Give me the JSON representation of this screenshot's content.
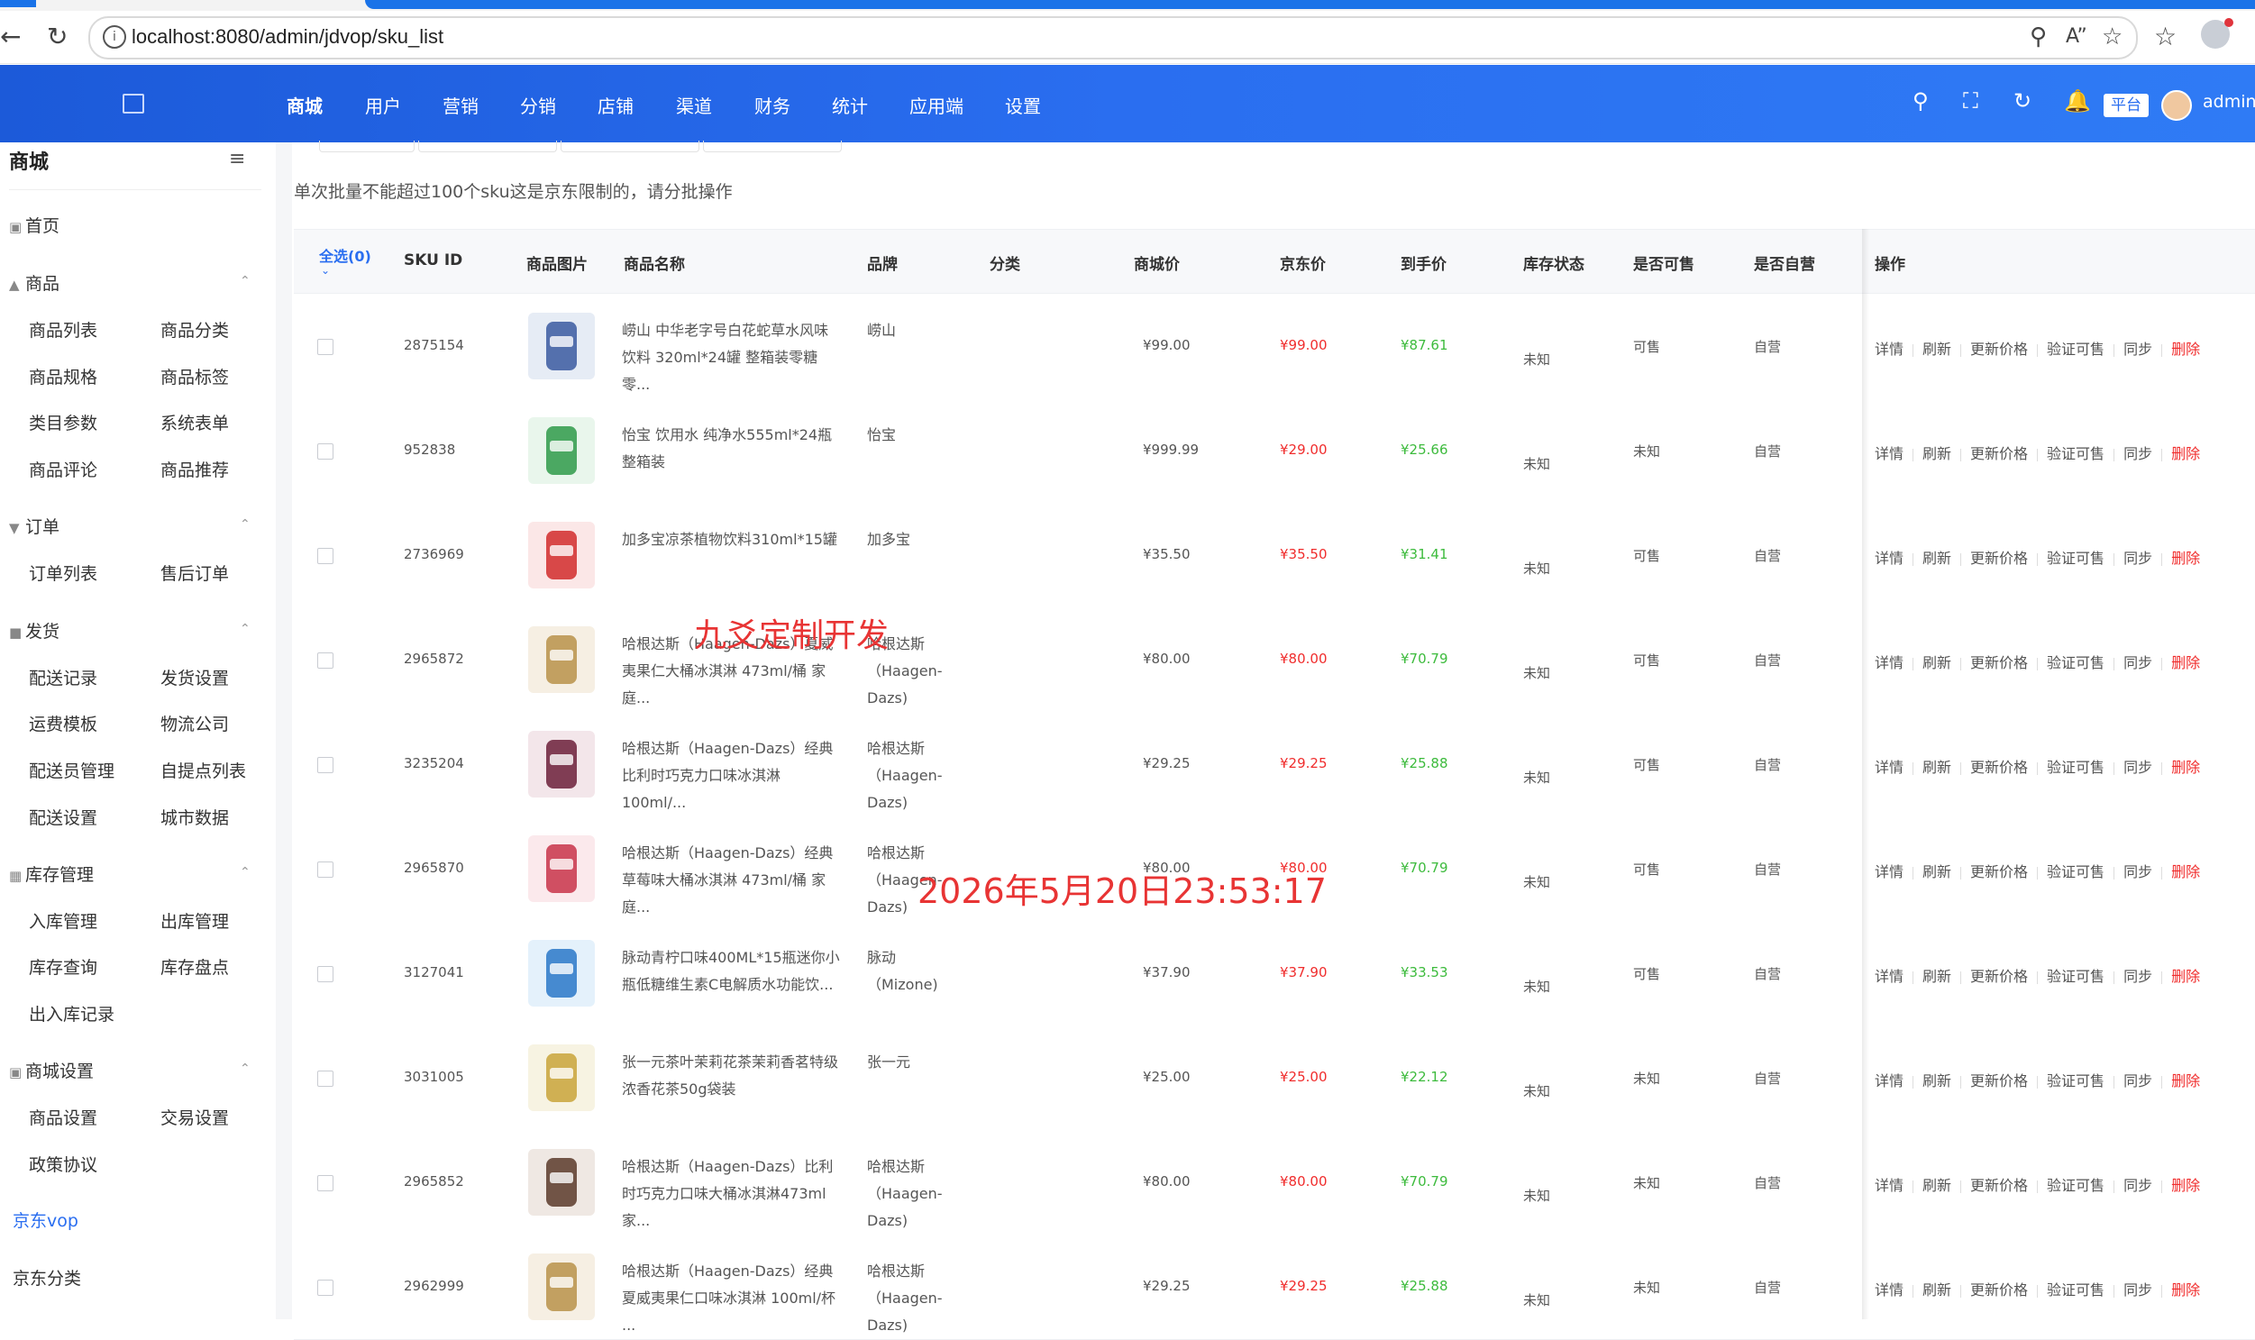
{
  "browser": {
    "url": "localhost:8080/admin/jdvop/sku_list"
  },
  "topnav": {
    "items": [
      "商城",
      "用户",
      "营销",
      "分销",
      "店铺",
      "渠道",
      "财务",
      "统计",
      "应用端",
      "设置"
    ],
    "platform_badge": "平台",
    "user": "admin"
  },
  "sidebar": {
    "title": "商城",
    "home": "首页",
    "sections": [
      {
        "title": "商品",
        "items": [
          "商品列表",
          "商品分类",
          "商品规格",
          "商品标签",
          "类目参数",
          "系统表单",
          "商品评论",
          "商品推荐"
        ]
      },
      {
        "title": "订单",
        "items": [
          "订单列表",
          "售后订单"
        ]
      },
      {
        "title": "发货",
        "items": [
          "配送记录",
          "发货设置",
          "运费模板",
          "物流公司",
          "配送员管理",
          "自提点列表",
          "配送设置",
          "城市数据"
        ]
      },
      {
        "title": "库存管理",
        "items": [
          "入库管理",
          "出库管理",
          "库存查询",
          "库存盘点",
          "出入库记录"
        ]
      },
      {
        "title": "商城设置",
        "items": [
          "商品设置",
          "交易设置",
          "政策协议"
        ]
      }
    ],
    "jd_vop": "京东vop",
    "jd_category": "京东分类"
  },
  "notice": "单次批量不能超过100个sku这是京东限制的，请分批操作",
  "table": {
    "select_all": "全选(0)",
    "headers": {
      "sku_id": "SKU ID",
      "image": "商品图片",
      "name": "商品名称",
      "brand": "品牌",
      "category": "分类",
      "mall_price": "商城价",
      "jd_price": "京东价",
      "final_price": "到手价",
      "stock": "库存状态",
      "saleable": "是否可售",
      "self_run": "是否自营",
      "ops": "操作"
    },
    "ops": [
      "详情",
      "刷新",
      "更新价格",
      "验证可售",
      "同步",
      "删除"
    ],
    "rows": [
      {
        "sku": "2875154",
        "name": "崂山 中华老字号白花蛇草水风味饮料 320ml*24罐 整箱装零糖零...",
        "brand": "崂山",
        "mall_price": "¥99.00",
        "jd_price": "¥99.00",
        "final_price": "¥87.61",
        "stock": "未知",
        "saleable": "可售",
        "self_run": "自营"
      },
      {
        "sku": "952838",
        "name": "怡宝 饮用水 纯净水555ml*24瓶 整箱装",
        "brand": "怡宝",
        "mall_price": "¥999.99",
        "jd_price": "¥29.00",
        "final_price": "¥25.66",
        "stock": "未知",
        "saleable": "未知",
        "self_run": "自营"
      },
      {
        "sku": "2736969",
        "name": "加多宝凉茶植物饮料310ml*15罐",
        "brand": "加多宝",
        "mall_price": "¥35.50",
        "jd_price": "¥35.50",
        "final_price": "¥31.41",
        "stock": "未知",
        "saleable": "可售",
        "self_run": "自营"
      },
      {
        "sku": "2965872",
        "name": "哈根达斯（Haagen-Dazs）夏威夷果仁大桶冰淇淋 473ml/桶 家庭...",
        "brand": "哈根达斯（Haagen-Dazs)",
        "mall_price": "¥80.00",
        "jd_price": "¥80.00",
        "final_price": "¥70.79",
        "stock": "未知",
        "saleable": "可售",
        "self_run": "自营"
      },
      {
        "sku": "3235204",
        "name": "哈根达斯（Haagen-Dazs）经典比利时巧克力口味冰淇淋 100ml/...",
        "brand": "哈根达斯（Haagen-Dazs)",
        "mall_price": "¥29.25",
        "jd_price": "¥29.25",
        "final_price": "¥25.88",
        "stock": "未知",
        "saleable": "可售",
        "self_run": "自营"
      },
      {
        "sku": "2965870",
        "name": "哈根达斯（Haagen-Dazs）经典草莓味大桶冰淇淋 473ml/桶 家庭...",
        "brand": "哈根达斯（Haagen-Dazs)",
        "mall_price": "¥80.00",
        "jd_price": "¥80.00",
        "final_price": "¥70.79",
        "stock": "未知",
        "saleable": "可售",
        "self_run": "自营"
      },
      {
        "sku": "3127041",
        "name": "脉动青柠口味400ML*15瓶迷你小瓶低糖维生素C电解质水功能饮...",
        "brand": "脉动（Mizone)",
        "mall_price": "¥37.90",
        "jd_price": "¥37.90",
        "final_price": "¥33.53",
        "stock": "未知",
        "saleable": "可售",
        "self_run": "自营"
      },
      {
        "sku": "3031005",
        "name": "张一元茶叶茉莉花茶茉莉香茗特级浓香花茶50g袋装",
        "brand": "张一元",
        "mall_price": "¥25.00",
        "jd_price": "¥25.00",
        "final_price": "¥22.12",
        "stock": "未知",
        "saleable": "未知",
        "self_run": "自营"
      },
      {
        "sku": "2965852",
        "name": "哈根达斯（Haagen-Dazs）比利时巧克力口味大桶冰淇淋473ml 家...",
        "brand": "哈根达斯（Haagen-Dazs)",
        "mall_price": "¥80.00",
        "jd_price": "¥80.00",
        "final_price": "¥70.79",
        "stock": "未知",
        "saleable": "未知",
        "self_run": "自营"
      },
      {
        "sku": "2962999",
        "name": "哈根达斯（Haagen-Dazs）经典夏威夷果仁口味冰淇淋 100ml/杯 ...",
        "brand": "哈根达斯（Haagen-Dazs)",
        "mall_price": "¥29.25",
        "jd_price": "¥29.25",
        "final_price": "¥25.88",
        "stock": "未知",
        "saleable": "未知",
        "self_run": "自营"
      }
    ]
  },
  "watermarks": {
    "brand": "九爻定制开发",
    "time": "2026年5月20日23:53:17"
  },
  "colors": {
    "primary": "#2a6ef0",
    "price_red": "#f02d2d",
    "price_green": "#3dbb3d"
  }
}
